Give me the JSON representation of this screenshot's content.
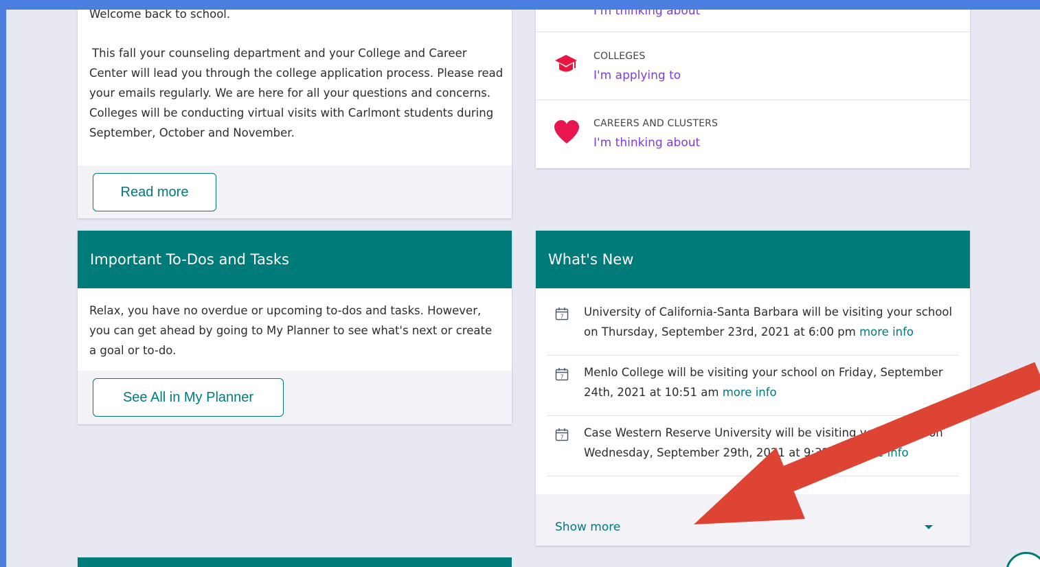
{
  "welcome_card": {
    "partial_line": "Welcome back to school.",
    "paragraph": "This fall your counseling department and your College and Career Center will lead you through the college application process. Please read your emails regularly. We are here for all your questions and concerns. Colleges will be conducting virtual visits with Carlmont students during September, October and November.",
    "read_more_label": "Read more"
  },
  "profile_card": {
    "partial_link": "I'm thinking about",
    "colleges": {
      "label": "COLLEGES",
      "link": "I'm applying to",
      "icon": "graduation-cap-icon"
    },
    "careers": {
      "label": "CAREERS AND CLUSTERS",
      "link": "I'm thinking about",
      "icon": "heart-icon"
    }
  },
  "todos_card": {
    "title": "Important To-Dos and Tasks",
    "message": "Relax, you have no overdue or upcoming to-dos and tasks. However, you can get ahead by going to My Planner to see what's next or create a goal or to-do.",
    "button_label": "See All in My Planner"
  },
  "whats_new_card": {
    "title": "What's New",
    "items": [
      {
        "text": "University of California-Santa Barbara will be visiting your school on Thursday, September 23rd, 2021 at 6:00 pm",
        "link": "more info",
        "icon": "calendar-icon"
      },
      {
        "text": "Menlo College will be visiting your school on Friday, September 24th, 2021 at 10:51 am",
        "link": "more info",
        "icon": "calendar-icon"
      },
      {
        "text": "Case Western Reserve University will be visiting your school on Wednesday, September 29th, 2021 at 9:32 am",
        "link": "more info",
        "icon": "calendar-icon"
      }
    ],
    "show_more_label": "Show more"
  },
  "colors": {
    "teal": "#017a7a",
    "purple_link": "#7a3ee0",
    "cap_red": "#e8163f",
    "heart_red": "#e8164e",
    "annotation_arrow": "#dd4433",
    "page_bg": "#e8e8f3",
    "frame_blue": "#4a7fe0"
  }
}
